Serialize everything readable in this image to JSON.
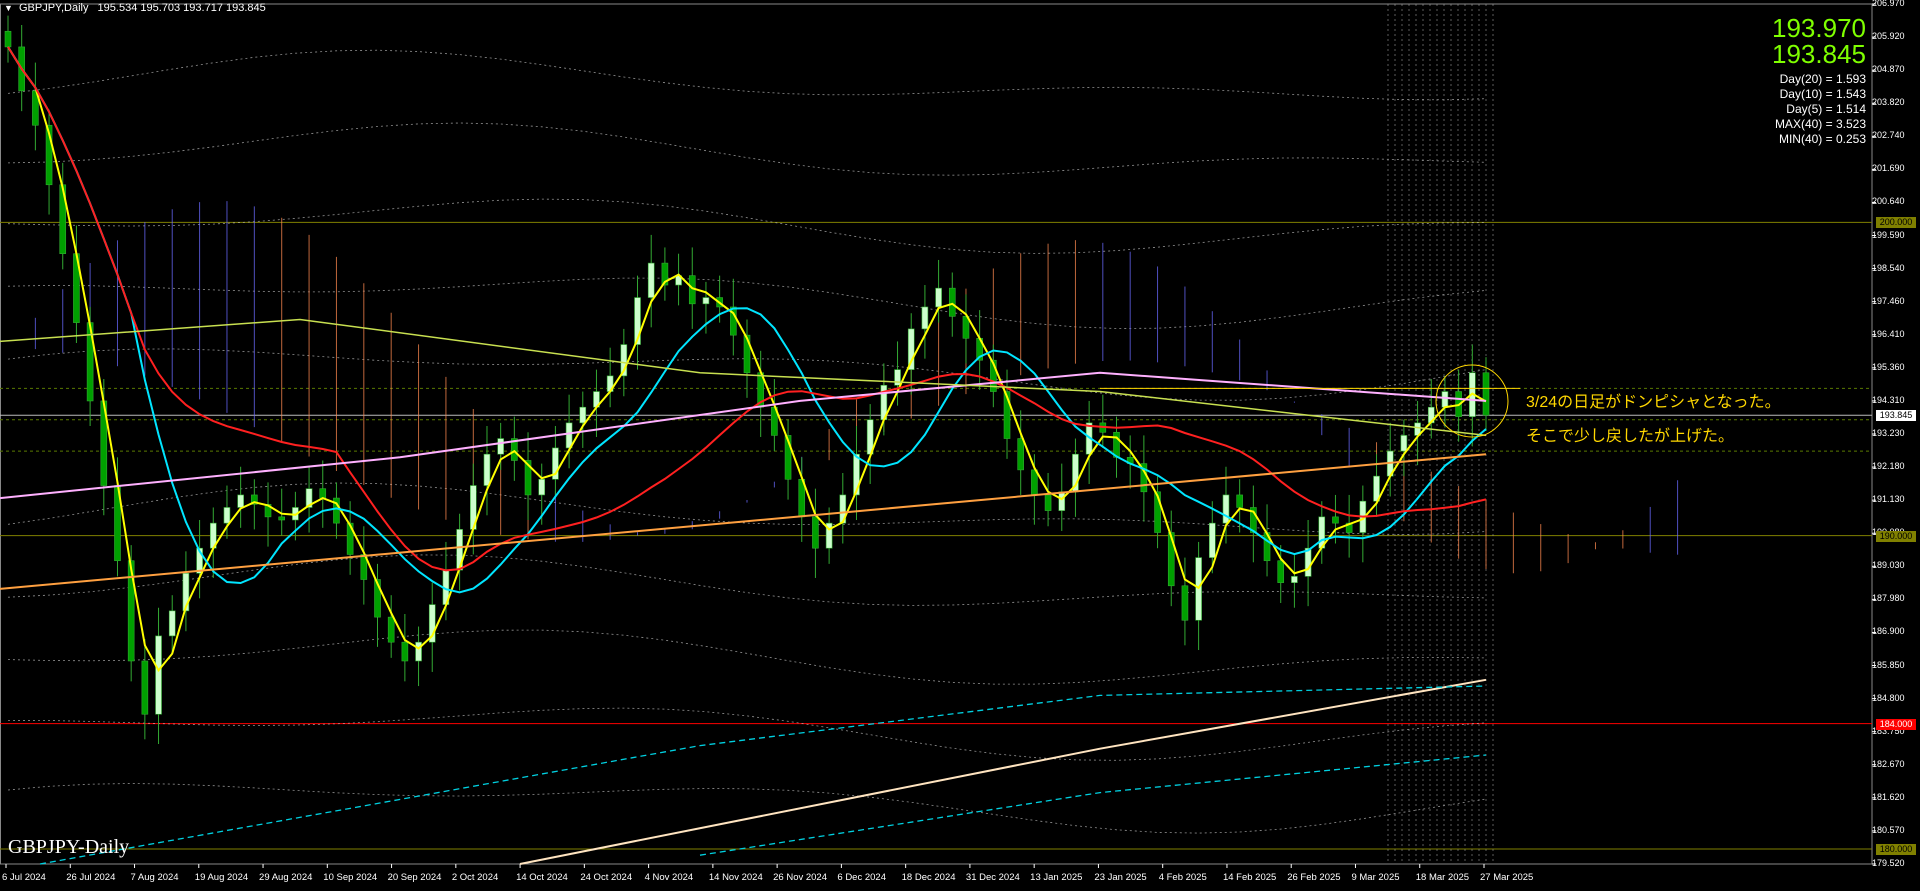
{
  "header": {
    "symbol_tf": "GBPJPY,Daily",
    "ohlc": "195.534 195.703 193.717 193.845"
  },
  "quote": {
    "ask": "193.970",
    "bid": "193.845"
  },
  "stats": [
    "Day(20) = 1.593",
    "Day(10) = 1.543",
    "Day(5) = 1.514",
    "MAX(40) = 3.523",
    "MIN(40) = 0.253"
  ],
  "annotations": {
    "line1": "3/24の日足がドンピシャとなった。",
    "line2": "そこで少し戻したが上げた。"
  },
  "watermark": "GBPJPY-Daily",
  "price_axis": {
    "min": 179.52,
    "max": 206.97,
    "labels": [
      "206.970",
      "205.920",
      "204.870",
      "203.820",
      "202.740",
      "201.690",
      "200.640",
      "199.590",
      "198.540",
      "197.460",
      "196.410",
      "195.360",
      "194.310",
      "193.230",
      "192.180",
      "191.130",
      "190.080",
      "189.030",
      "187.980",
      "186.900",
      "185.850",
      "184.800",
      "183.750",
      "182.670",
      "181.620",
      "180.570",
      "179.520"
    ],
    "current_price": "193.845",
    "tags": [
      {
        "text": "200.000",
        "color": "#808000",
        "value": 200.0
      },
      {
        "text": "190.000",
        "color": "#808000",
        "value": 190.0
      },
      {
        "text": "184.000",
        "color": "#ff0000",
        "value": 184.0
      },
      {
        "text": "180.000",
        "color": "#808000",
        "value": 180.0
      }
    ]
  },
  "time_axis": {
    "labels": [
      "6 Jul 2024",
      "26 Jul 2024",
      "7 Aug 2024",
      "19 Aug 2024",
      "29 Aug 2024",
      "10 Sep 2024",
      "20 Sep 2024",
      "2 Oct 2024",
      "14 Oct 2024",
      "24 Oct 2024",
      "4 Nov 2024",
      "14 Nov 2024",
      "26 Nov 2024",
      "6 Dec 2024",
      "18 Dec 2024",
      "31 Dec 2024",
      "13 Jan 2025",
      "23 Jan 2025",
      "4 Feb 2025",
      "14 Feb 2025",
      "26 Feb 2025",
      "9 Mar 2025",
      "18 Mar 2025",
      "27 Mar 2025"
    ]
  },
  "colors": {
    "background": "#000000",
    "bull_candle": "#ccffcc",
    "bear_candle": "#00a000",
    "ma_fast": "#ffff00",
    "ma_mid": "#00e5ff",
    "ma_slow": "#ff2020",
    "ma_long": "#ffa040",
    "ma_pink": "#ffb0ff",
    "cloud_bull": "#6a6aff",
    "cloud_bear": "#ff8a50",
    "annotation": "#ffd700",
    "quote": "#7fff00"
  },
  "chart_data": {
    "type": "candlestick",
    "symbol": "GBPJPY",
    "timeframe": "Daily",
    "last_bar": {
      "open": 195.534,
      "high": 195.703,
      "low": 193.717,
      "close": 193.845
    },
    "y_range": [
      179.52,
      206.97
    ],
    "close_series": [
      205.6,
      204.2,
      203.1,
      201.2,
      199.0,
      196.8,
      194.3,
      191.6,
      189.2,
      186.0,
      184.3,
      186.8,
      187.6,
      188.8,
      189.6,
      190.4,
      190.9,
      191.3,
      191.0,
      190.6,
      190.5,
      190.9,
      191.5,
      191.2,
      190.4,
      189.4,
      188.6,
      187.4,
      186.6,
      186.0,
      186.6,
      187.8,
      188.9,
      190.2,
      191.6,
      192.6,
      193.1,
      192.4,
      191.3,
      191.8,
      192.8,
      193.6,
      194.1,
      194.6,
      195.1,
      196.1,
      197.6,
      198.7,
      198.0,
      198.3,
      197.4,
      197.6,
      197.3,
      196.4,
      195.2,
      194.1,
      193.2,
      191.8,
      190.6,
      189.6,
      190.4,
      191.3,
      192.6,
      193.7,
      194.8,
      195.3,
      196.6,
      197.3,
      197.9,
      197.0,
      196.3,
      195.6,
      194.6,
      193.1,
      192.1,
      191.3,
      190.8,
      191.4,
      192.6,
      193.6,
      193.3,
      192.5,
      192.3,
      191.4,
      190.1,
      188.4,
      187.3,
      189.3,
      190.4,
      191.3,
      190.9,
      190.1,
      189.2,
      188.5,
      188.7,
      189.6,
      190.6,
      190.4,
      190.1,
      191.1,
      191.9,
      192.7,
      193.2,
      193.6,
      194.1,
      194.6,
      193.8,
      195.2,
      193.845
    ]
  }
}
